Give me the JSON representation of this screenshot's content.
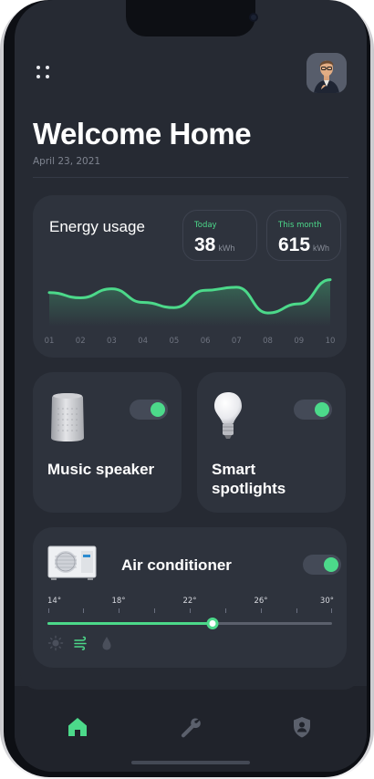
{
  "header": {
    "title": "Welcome Home",
    "date": "April 23, 2021"
  },
  "energy": {
    "label": "Energy usage",
    "today": {
      "label": "Today",
      "value": "38",
      "unit": "kWh"
    },
    "month": {
      "label": "This month",
      "value": "615",
      "unit": "kWh"
    },
    "chart_data": {
      "type": "area",
      "categories": [
        "01",
        "02",
        "03",
        "04",
        "05",
        "06",
        "07",
        "08",
        "09",
        "10"
      ],
      "values": [
        45,
        38,
        50,
        32,
        25,
        48,
        52,
        18,
        30,
        62
      ],
      "color": "#4cd98a"
    }
  },
  "devices": {
    "speaker": {
      "label": "Music speaker",
      "icon": "speaker-icon",
      "on": true
    },
    "spotlights": {
      "label": "Smart spotlights",
      "icon": "lightbulb-icon",
      "on": true
    }
  },
  "ac": {
    "label": "Air conditioner",
    "icon": "air-conditioner-icon",
    "on": true,
    "temps": [
      "14°",
      "18°",
      "22°",
      "26°",
      "30°"
    ],
    "level": 0.58,
    "modes": [
      "sun-icon",
      "wind-icon",
      "drop-icon"
    ],
    "active_mode": "wind-icon"
  },
  "nav": {
    "items": [
      "home-icon",
      "wrench-icon",
      "shield-user-icon"
    ],
    "active": "home-icon"
  },
  "colors": {
    "accent": "#4cd98a",
    "background": "#262a33",
    "card": "#2e333d"
  }
}
